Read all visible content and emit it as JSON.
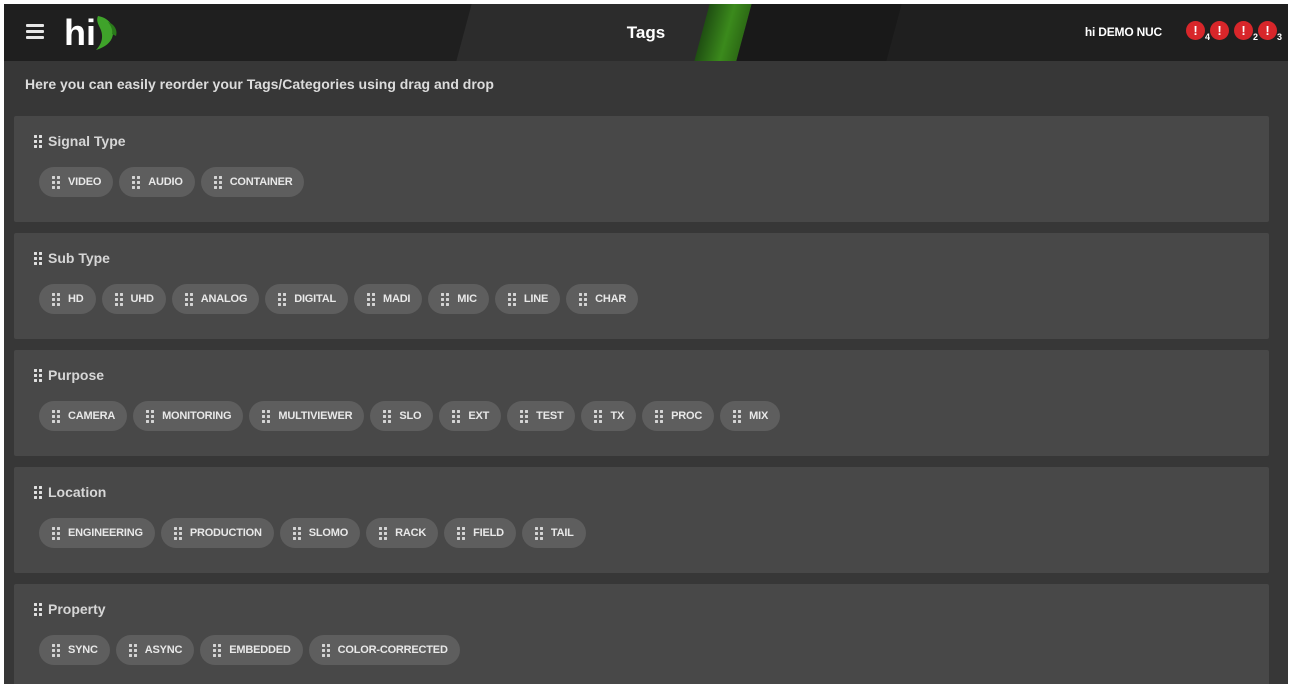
{
  "header": {
    "logo_text": "hi",
    "title": "Tags",
    "device_name": "hi DEMO NUC",
    "alerts": [
      {
        "icon": "alert-icon",
        "count": "4"
      },
      {
        "icon": "alert-icon",
        "count": ""
      },
      {
        "icon": "alert-icon",
        "count": "2"
      },
      {
        "icon": "alert-icon",
        "count": "3"
      }
    ]
  },
  "intro": "Here you can easily reorder your Tags/Categories using drag and drop",
  "categories": [
    {
      "name": "Signal Type",
      "tags": [
        "VIDEO",
        "AUDIO",
        "CONTAINER"
      ]
    },
    {
      "name": "Sub Type",
      "tags": [
        "HD",
        "UHD",
        "ANALOG",
        "DIGITAL",
        "MADI",
        "MIC",
        "LINE",
        "CHAR"
      ]
    },
    {
      "name": "Purpose",
      "tags": [
        "CAMERA",
        "MONITORING",
        "MULTIVIEWER",
        "SLO",
        "EXT",
        "TEST",
        "TX",
        "PROC",
        "MIX"
      ]
    },
    {
      "name": "Location",
      "tags": [
        "ENGINEERING",
        "PRODUCTION",
        "SLOMO",
        "RACK",
        "FIELD",
        "TAIL"
      ]
    },
    {
      "name": "Property",
      "tags": [
        "SYNC",
        "ASYNC",
        "EMBEDDED",
        "COLOR-CORRECTED"
      ]
    }
  ],
  "colors": {
    "background": "#373737",
    "card": "#484848",
    "chip": "#5e5e5e",
    "topbar": "#1f1f1f",
    "accent_green": "#3b8a1c",
    "alert_red": "#d8262a"
  }
}
